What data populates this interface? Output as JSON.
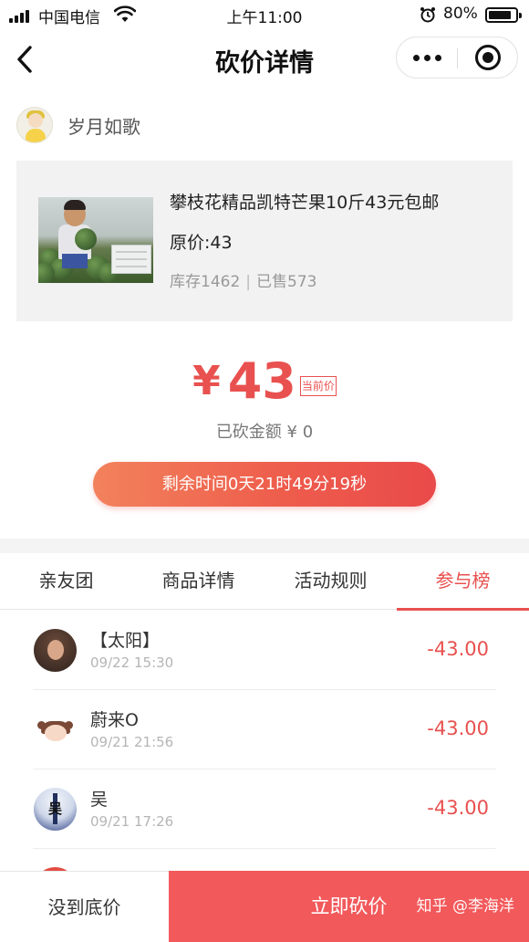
{
  "status_bar": {
    "carrier": "中国电信",
    "time": "上午11:00",
    "battery_percent": "80%",
    "battery_level": 0.8
  },
  "nav": {
    "title": "砍价详情",
    "icons": [
      "back-icon",
      "more-icon",
      "close-icon"
    ]
  },
  "user": {
    "name": "岁月如歌"
  },
  "product": {
    "title": "攀枝花精品凯特芒果10斤43元包邮",
    "original_price": "原价:43",
    "stock": "库存1462",
    "sold": "已售573",
    "separator": "|"
  },
  "price": {
    "symbol": "¥",
    "current": "43",
    "tag": "当前价",
    "cut_amount": "已砍金额 ¥ 0"
  },
  "timer": {
    "text": "剩余时间0天21时49分19秒"
  },
  "tabs": [
    {
      "label": "亲友团",
      "active": false
    },
    {
      "label": "商品详情",
      "active": false
    },
    {
      "label": "活动规则",
      "active": false
    },
    {
      "label": "参与榜",
      "active": true
    }
  ],
  "ranking": [
    {
      "name": "【太阳】",
      "time": "09/22 15:30",
      "amount": "-43.00"
    },
    {
      "name": "蔚来O",
      "time": "09/21 21:56",
      "amount": "-43.00"
    },
    {
      "name": "吴",
      "time": "09/21 17:26",
      "amount": "-43.00",
      "avatar_text": "吴"
    },
    {
      "name": "",
      "time": "",
      "amount": ""
    }
  ],
  "bottom": {
    "floor_label": "没到底价",
    "cut_label": "立即砍价",
    "watermark": "知乎 @李海洋"
  },
  "colors": {
    "accent": "#e8514f",
    "button_red": "#f2595b",
    "timer_gradient_start": "#f2825c",
    "timer_gradient_end": "#e94a4a"
  }
}
